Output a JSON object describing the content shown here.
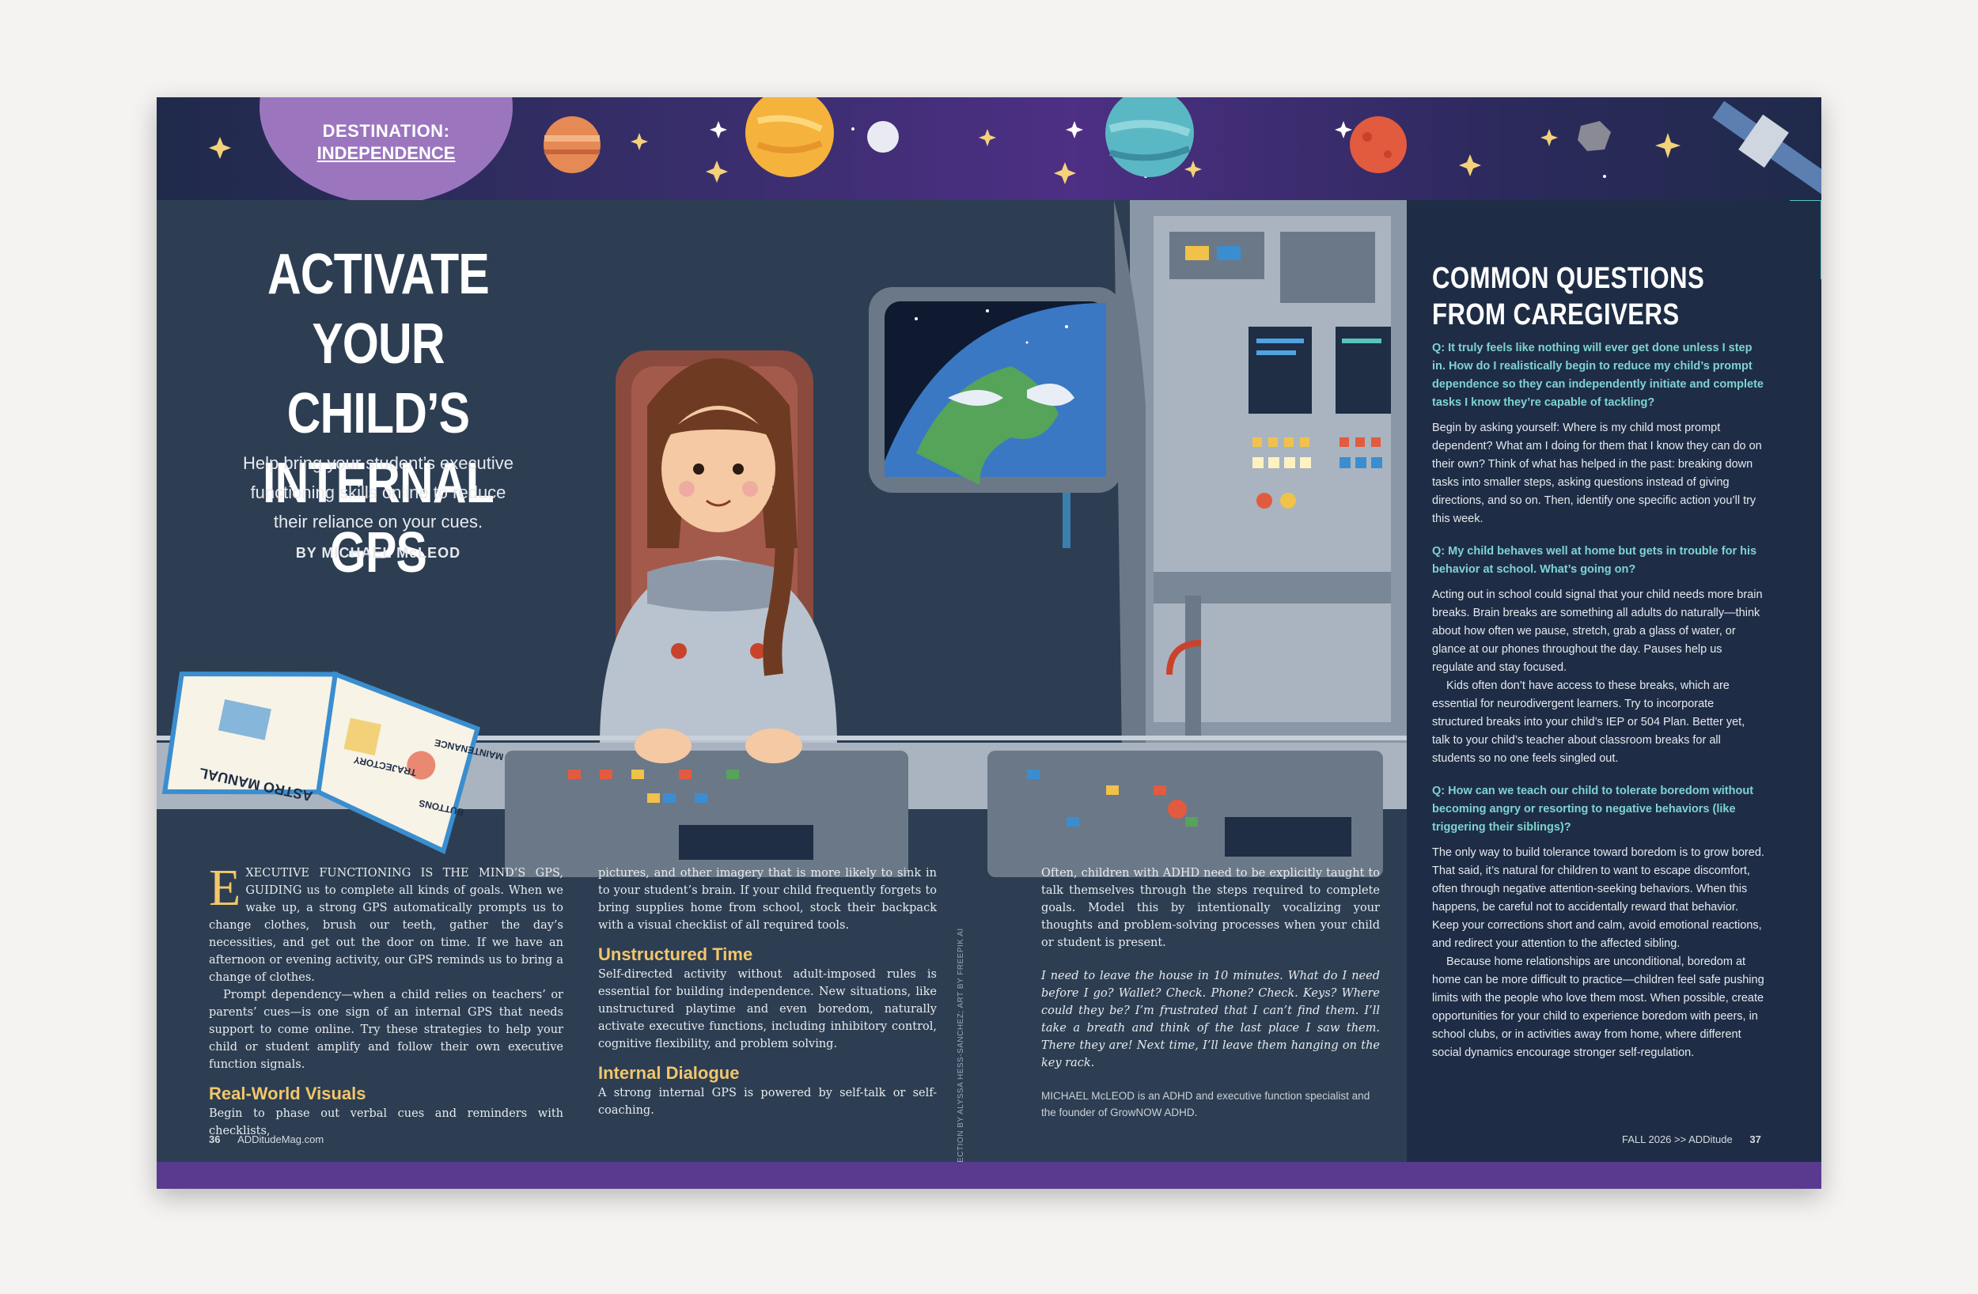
{
  "badge": {
    "line1": "DESTINATION:",
    "line2": "INDEPENDENCE"
  },
  "headline": {
    "line1": "ACTIVATE",
    "line2": "YOUR CHILD’S",
    "line3": "INTERNAL GPS"
  },
  "deck": {
    "line1": "Help bring your student’s executive",
    "line2": "functioning skills online to reduce",
    "line3": "their reliance on your cues."
  },
  "byline": "BY MICHAEL McLEOD",
  "illustration": {
    "book_title": "ASTRO MANUAL",
    "book_label_1": "TRAJECTORY",
    "book_label_2": "BUTTONS",
    "book_label_3": "MAINTENANCE"
  },
  "article": {
    "dropcap": "E",
    "intro": "XECUTIVE FUNCTIONING IS THE MIND’S GPS, GUIDING us to complete all kinds of goals. When we wake up, a strong GPS automatically prompts us to change clothes, brush our teeth, gather the day’s necessities, and get out the door on time. If we have an afternoon or evening activity, our GPS reminds us to bring a change of clothes.",
    "para2": "Prompt dependency—when a child relies on teachers’ or parents’ cues—is one sign of an internal GPS that needs support to come online. Try these strategies to help your child or student amplify and follow their own executive function signals.",
    "h_visuals": "Real-World Visuals",
    "visuals_a": "Begin to phase out verbal cues and reminders with checklists,",
    "visuals_b": "pictures, and other imagery that is more likely to sink in to your student’s brain. If your child frequently forgets to bring supplies home from school, stock their backpack with a visual checklist of all required tools.",
    "h_unstructured": "Unstructured Time",
    "unstructured": "Self-directed activity without adult-imposed rules is essential for building independence. New situations, like unstructured playtime and even boredom, naturally activate executive functions, including inhibitory control, cognitive flexibility, and problem solving.",
    "h_dialogue": "Internal Dialogue",
    "dialogue_a": "A strong internal GPS is powered by self-talk or self-coaching.",
    "dialogue_b": "Often, children with ADHD need to be explicitly taught to talk themselves through the steps required to complete goals. Model this by intentionally vocalizing your thoughts and problem-solving processes when your child or student is present.",
    "italic_example": "I need to leave the house in 10 minutes. What do I need before I go? Wallet? Check. Phone? Check. Keys? Where could they be? I’m frustrated that I can’t find them. I’ll take a breath and think of the last place I saw them. There they are! Next time, I’ll leave them hanging on the key rack.",
    "bio_name": "MICHAEL McLEOD",
    "bio_text": " is an ADHD and executive function specialist and the founder of GrowNOW ADHD."
  },
  "credit": "ART DIRECTION BY ALYSSA HESS-SANCHEZ; ART BY FREEPIK AI",
  "sidebar": {
    "title_line1": "COMMON QUESTIONS",
    "title_line2": "FROM CAREGIVERS",
    "q1": "Q: It truly feels like nothing will ever get done unless I step in. How do I realistically begin to reduce my child’s prompt dependence so they can independently initiate and complete tasks I know they’re capable of tackling?",
    "a1": "Begin by asking yourself: Where is my child most prompt dependent? What am I doing for them that I know they can do on their own? Think of what has helped in the past: breaking down tasks into smaller steps, asking questions instead of giving directions, and so on. Then, identify one specific action you’ll try this week.",
    "q2": "Q: My child behaves well at home but gets in trouble for his behavior at school. What’s going on?",
    "a2": "Acting out in school could signal that your child needs more brain breaks. Brain breaks are something all adults do naturally—think about how often we pause, stretch, grab a glass of water, or glance at our phones throughout the day. Pauses help us regulate and stay focused.",
    "a2b": "Kids often don’t have access to these breaks, which are essential for neurodivergent learners. Try to incorporate structured breaks into your child’s IEP or 504 Plan. Better yet, talk to your child’s teacher about classroom breaks for all students so no one feels singled out.",
    "q3": "Q: How can we teach our child to tolerate boredom without becoming angry or resorting to negative behaviors (like triggering their siblings)?",
    "a3": "The only way to build tolerance toward boredom is to grow bored. That said, it’s natural for children to want to escape discomfort, often through negative attention-seeking behaviors. When this happens, be careful not to accidentally reward that behavior. Keep your corrections short and calm, avoid emotional reactions, and redirect your attention to the affected sibling.",
    "a3b": "Because home relationships are unconditional, boredom at home can be more difficult to practice—children feel safe pushing limits with the people who love them most. When possible, create opportunities for your child to experience boredom with peers, in school clubs, or in activities away from home, where different social dynamics encourage stronger self-regulation."
  },
  "footer": {
    "left_page": "36",
    "left_site": "ADDitudeMag.com",
    "right_issue": "FALL 2026 >> ",
    "right_brand": "ADDitude",
    "right_page": "37"
  },
  "colors": {
    "background": "#2d3e52",
    "sidebar": "#1e2d45",
    "accent_gold": "#f2c66b",
    "accent_teal": "#7fd3cf",
    "purple": "#9b76bf"
  }
}
